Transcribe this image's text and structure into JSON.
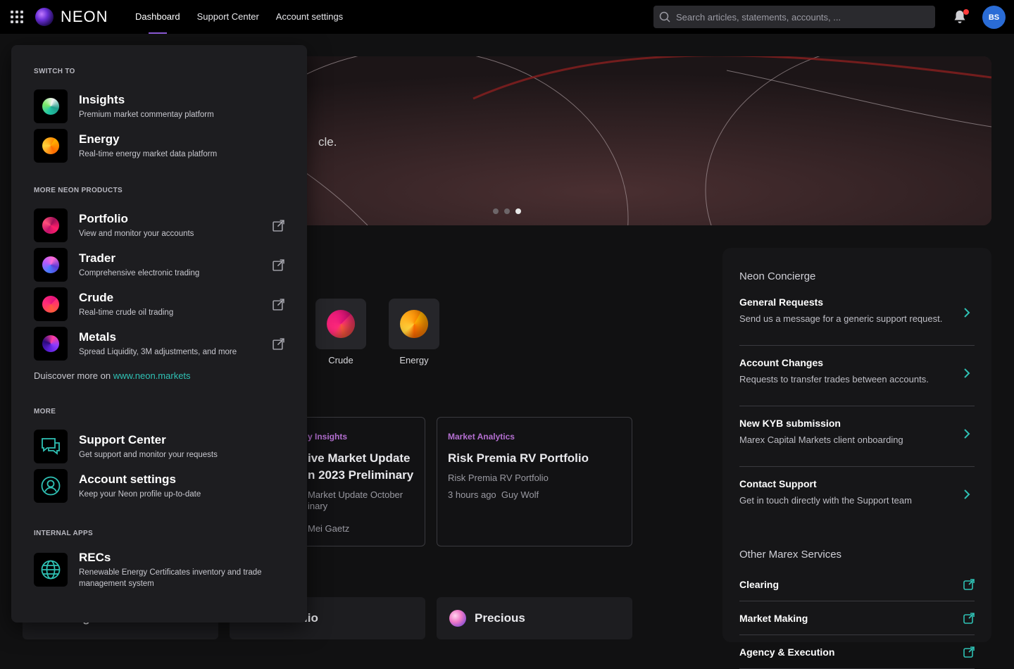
{
  "app": {
    "brand": "NEON"
  },
  "nav": {
    "dashboard": "Dashboard",
    "support": "Support Center",
    "account": "Account settings"
  },
  "search": {
    "placeholder": "Search articles, statements, accounts, ..."
  },
  "user": {
    "initials": "BS"
  },
  "hero": {
    "text_fragment": "cle.",
    "slides": 3,
    "active_slide": 3
  },
  "apps": [
    {
      "label": "Crude"
    },
    {
      "label": "Energy"
    }
  ],
  "cards": [
    {
      "category": "y Insights",
      "title_line1": "ive Market Update",
      "title_line2": "n 2023 Preliminary",
      "sub_line1": "Market Update October",
      "sub_line2": "inary",
      "meta": "Mei Gaetz"
    },
    {
      "category": "Market Analytics",
      "title": "Risk Premia RV Portfolio",
      "sub": "Risk Premia RV Portfolio",
      "time": "3 hours ago",
      "author": "Guy Wolf"
    }
  ],
  "bottom_cards": [
    {
      "label": "Insights"
    },
    {
      "label": "Portfolio"
    },
    {
      "label": "Precious"
    }
  ],
  "concierge": {
    "title": "Neon Concierge",
    "items": [
      {
        "title": "General Requests",
        "desc": "Send us a message for a generic support request."
      },
      {
        "title": "Account Changes",
        "desc": "Requests to transfer trades between accounts."
      },
      {
        "title": "New KYB submission",
        "desc": "Marex Capital Markets client onboarding"
      },
      {
        "title": "Contact Support",
        "desc": "Get in touch directly with the Support team"
      }
    ],
    "other_title": "Other Marex Services",
    "other": [
      {
        "title": "Clearing"
      },
      {
        "title": "Market Making"
      },
      {
        "title": "Agency & Execution"
      }
    ]
  },
  "switcher": {
    "switch_to": "SWITCH TO",
    "switch_items": [
      {
        "name": "Insights",
        "desc": "Premium market commentay platform"
      },
      {
        "name": "Energy",
        "desc": "Real-time energy market data platform"
      }
    ],
    "more_products": "MORE NEON PRODUCTS",
    "product_items": [
      {
        "name": "Portfolio",
        "desc": "View and monitor your accounts"
      },
      {
        "name": "Trader",
        "desc": "Comprehensive electronic trading"
      },
      {
        "name": "Crude",
        "desc": "Real-time crude oil trading"
      },
      {
        "name": "Metals",
        "desc": "Spread Liquidity, 3M adjustments, and more"
      }
    ],
    "discover_prefix": "Duiscover more on ",
    "discover_link": "www.neon.markets",
    "more": "MORE",
    "more_items": [
      {
        "name": "Support Center",
        "desc": "Get support and monitor your requests"
      },
      {
        "name": "Account settings",
        "desc": "Keep your Neon profile up-to-date"
      }
    ],
    "internal": "INTERNAL APPS",
    "internal_items": [
      {
        "name": "RECs",
        "desc_line1": "Renewable Energy Certificates inventory and trade",
        "desc_line2": "management system"
      }
    ]
  },
  "colors": {
    "accent": "#8e5bd9",
    "teal": "#2fc1b4",
    "category": "#b46fd1",
    "avatar": "#2a6cd6",
    "notification": "#ff3b3b"
  }
}
